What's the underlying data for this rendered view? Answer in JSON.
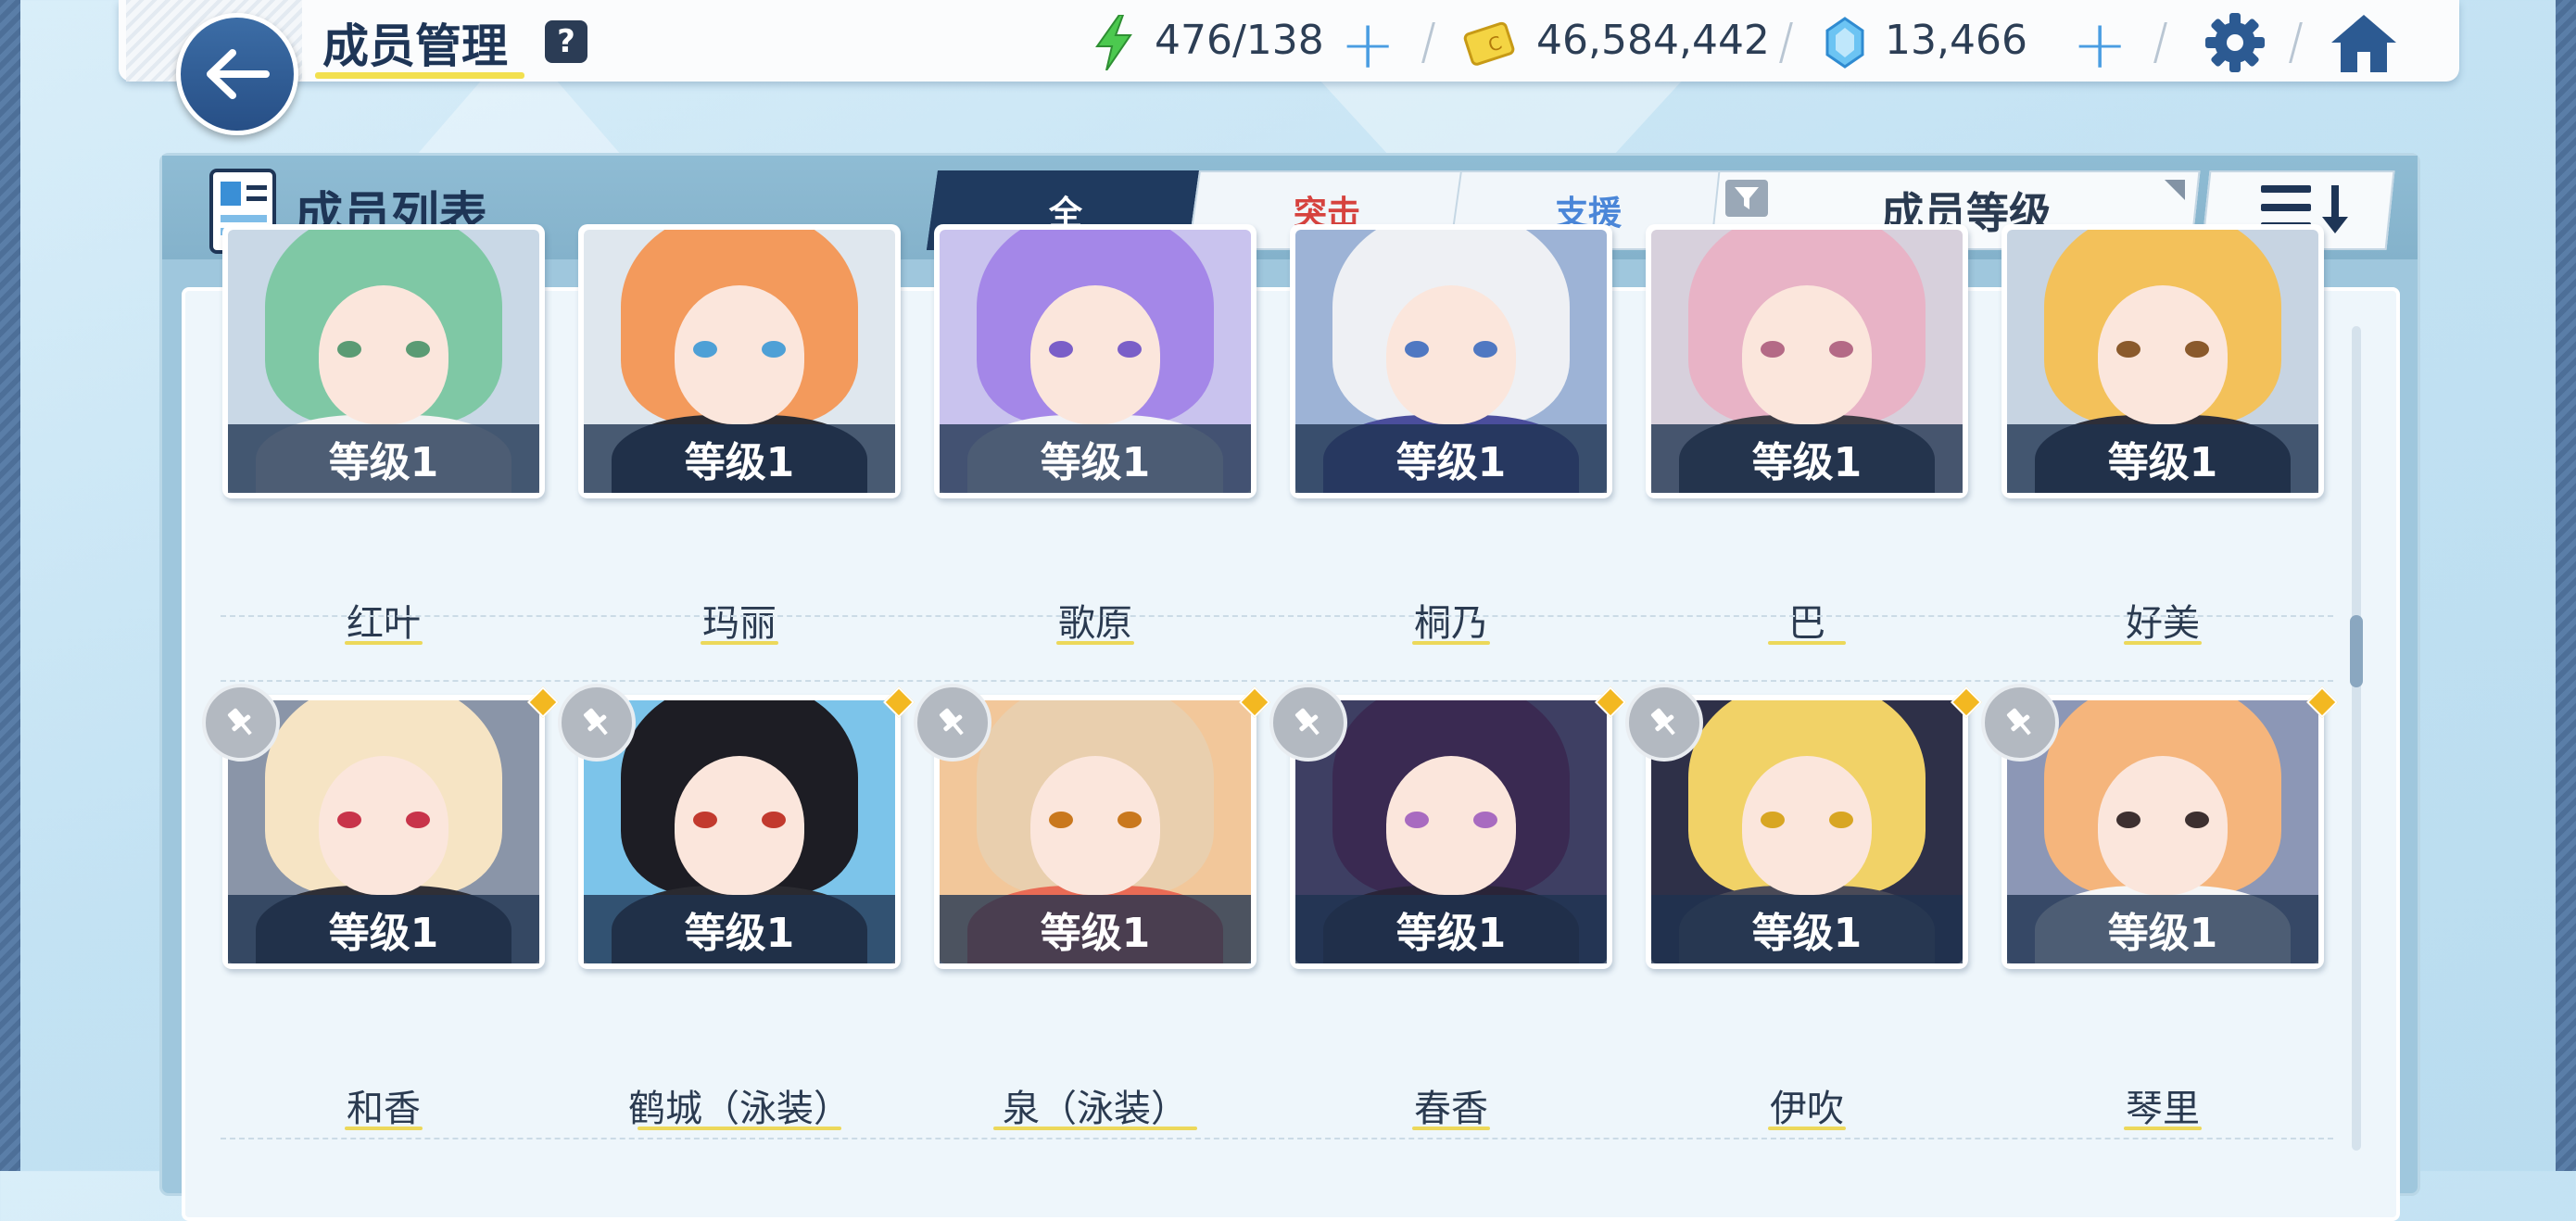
{
  "header": {
    "title": "成员管理",
    "help_label": "?",
    "resources": {
      "stamina": "476/138",
      "credits": "46,584,442",
      "gems": "13,466"
    }
  },
  "panel": {
    "title": "成员列表",
    "tabs": [
      {
        "label": "全",
        "color": "#ffffff",
        "active": true
      },
      {
        "label": "突击",
        "color": "#d6423e",
        "active": false
      },
      {
        "label": "支援",
        "color": "#4a86d8",
        "active": false
      }
    ],
    "sort_label": "成员等级"
  },
  "members": [
    {
      "name": "红叶",
      "level": "等级1",
      "hair": "#7fc8a5",
      "eyes": "#5a9b74",
      "outfit": "#f3f3f3",
      "bg": "#c9d8e6",
      "pinned": false
    },
    {
      "name": "玛丽",
      "level": "等级1",
      "hair": "#f39a5c",
      "eyes": "#4ea0d6",
      "outfit": "#2b2b32",
      "bg": "#dfe7ee",
      "pinned": false
    },
    {
      "name": "歌原",
      "level": "等级1",
      "hair": "#a487e8",
      "eyes": "#7a5fc8",
      "outfit": "#f1f2f7",
      "bg": "#c9c3ee",
      "pinned": false
    },
    {
      "name": "桐乃",
      "level": "等级1",
      "hair": "#eef0f4",
      "eyes": "#4f78c2",
      "outfit": "#4b4e9c",
      "bg": "#9db3d6",
      "pinned": false
    },
    {
      "name": "巴",
      "level": "等级1",
      "hair": "#e8b3c6",
      "eyes": "#b46a86",
      "outfit": "#3d3c45",
      "bg": "#d7d0dc",
      "pinned": false
    },
    {
      "name": "好美",
      "level": "等级1",
      "hair": "#f3c15a",
      "eyes": "#8a5a2c",
      "outfit": "#2e2e38",
      "bg": "#c7d4e2",
      "pinned": false
    },
    {
      "name": "和香",
      "level": "等级1",
      "hair": "#f6e4c4",
      "eyes": "#c8344a",
      "outfit": "#2f2f36",
      "bg": "#8a95a8",
      "pinned": true
    },
    {
      "name": "鹤城（泳装）",
      "level": "等级1",
      "hair": "#1d1d24",
      "eyes": "#c23a2e",
      "outfit": "#2a2a30",
      "bg": "#7cc4ea",
      "pinned": true
    },
    {
      "name": "泉（泳装）",
      "level": "等级1",
      "hair": "#e9cfae",
      "eyes": "#c9781e",
      "outfit": "#e96b55",
      "bg": "#f2c79a",
      "pinned": true
    },
    {
      "name": "春香",
      "level": "等级1",
      "hair": "#3a2a52",
      "eyes": "#a86bc0",
      "outfit": "#2a2438",
      "bg": "#3e3f63",
      "pinned": true
    },
    {
      "name": "伊吹",
      "level": "等级1",
      "hair": "#f1d267",
      "eyes": "#d8a623",
      "outfit": "#4a4a57",
      "bg": "#2e3048",
      "pinned": true
    },
    {
      "name": "琴里",
      "level": "等级1",
      "hair": "#f5b57c",
      "eyes": "#3d3030",
      "outfit": "#f6f6f6",
      "bg": "#8c97b6",
      "pinned": true
    }
  ]
}
